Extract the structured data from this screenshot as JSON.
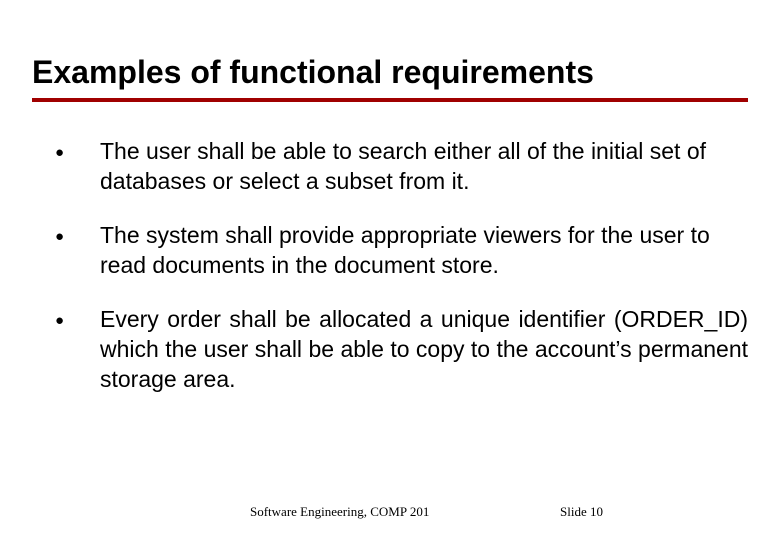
{
  "title": "Examples of functional requirements",
  "bullets": {
    "b0": "The user shall be able to search either all of the initial set of databases or select a subset from it.",
    "b1": "The system shall provide appropriate viewers for the user to read documents in the document store.",
    "b2": "Every order shall be allocated a unique identifier (ORDER_ID) which the user shall be able to copy to the account’s permanent storage area."
  },
  "footer": {
    "course": "Software Engineering, COMP 201",
    "slide_label": "Slide  10"
  }
}
